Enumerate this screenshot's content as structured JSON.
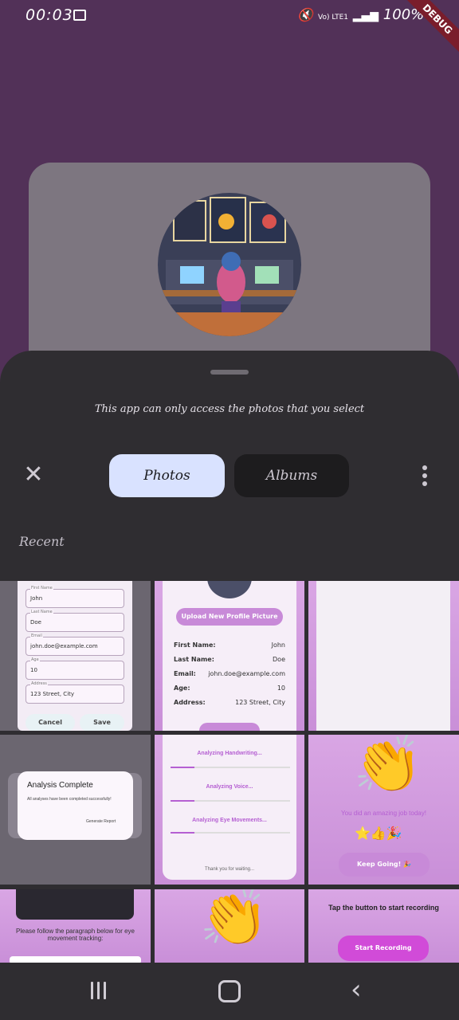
{
  "status_bar": {
    "time": "00:03",
    "battery": "100%",
    "network_label": "Vo) LTE1"
  },
  "debug_banner": "DEBUG",
  "picker": {
    "notice": "This app can only access the photos that you select",
    "tabs": [
      {
        "label": "Photos",
        "selected": true
      },
      {
        "label": "Albums",
        "selected": false
      }
    ],
    "section_title": "Recent"
  },
  "thumbnails": {
    "form": {
      "fields": [
        {
          "label": "First Name",
          "value": "John"
        },
        {
          "label": "Last Name",
          "value": "Doe"
        },
        {
          "label": "Email",
          "value": "john.doe@example.com"
        },
        {
          "label": "Age",
          "value": "10"
        },
        {
          "label": "Address",
          "value": "123 Street, City"
        }
      ],
      "cancel": "Cancel",
      "save": "Save"
    },
    "profile": {
      "upload": "Upload New Profile Picture",
      "rows": [
        {
          "label": "First Name:",
          "value": "John"
        },
        {
          "label": "Last Name:",
          "value": "Doe"
        },
        {
          "label": "Email:",
          "value": "john.doe@example.com"
        },
        {
          "label": "Age:",
          "value": "10"
        },
        {
          "label": "Address:",
          "value": "123 Street, City"
        }
      ]
    },
    "dialog": {
      "title": "Analysis Complete",
      "body": "All analyses have been completed successfully!",
      "action": "Generate Report"
    },
    "analysis": {
      "items": [
        "Analyzing Handwriting...",
        "Analyzing Voice...",
        "Analyzing Eye Movements..."
      ],
      "footer": "Thank you for waiting..."
    },
    "praise": {
      "message": "You did an amazing job today!",
      "button": "Keep Going! 🎉"
    },
    "eye": {
      "text": "Please follow the paragraph below for eye movement tracking:"
    },
    "record": {
      "title": "Tap the button to start recording",
      "button": "Start Recording"
    }
  }
}
